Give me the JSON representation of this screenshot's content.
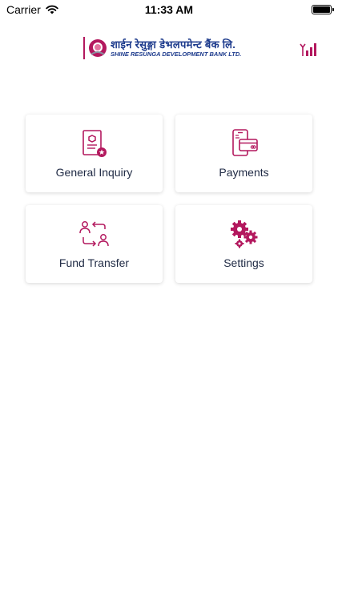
{
  "status_bar": {
    "carrier": "Carrier",
    "time": "11:33 AM"
  },
  "header": {
    "bank_name_nepali": "शाईन रेसुङ्गा डेभलपमेन्ट बैंक लि.",
    "bank_name_english": "SHINE RESUNGA DEVELOPMENT BANK LTD.",
    "signal_icon": "signal-icon"
  },
  "menu": {
    "items": [
      {
        "label": "General Inquiry",
        "icon": "document-icon"
      },
      {
        "label": "Payments",
        "icon": "card-phone-icon"
      },
      {
        "label": "Fund Transfer",
        "icon": "transfer-icon"
      },
      {
        "label": "Settings",
        "icon": "gears-icon"
      }
    ]
  },
  "colors": {
    "accent": "#b3185e",
    "brand_blue": "#1c3a8c",
    "label_text": "#1f2a44"
  }
}
